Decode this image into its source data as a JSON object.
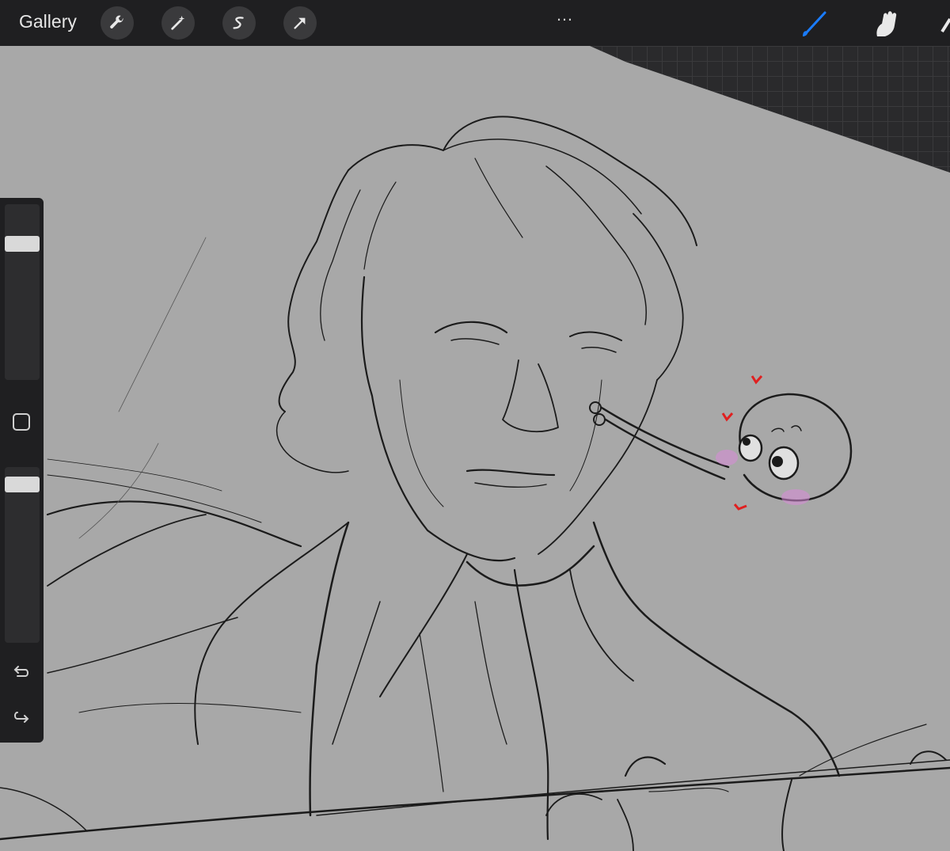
{
  "app": {
    "gallery_label": "Gallery",
    "more_icon": "…"
  },
  "toolbar": {
    "left_tools": [
      "actions-wrench-icon",
      "adjustments-wand-icon",
      "selection-s-icon",
      "transform-arrow-icon"
    ],
    "right_tools": [
      "brush-icon",
      "smudge-icon",
      "eraser-icon"
    ],
    "active_tool": "brush-icon",
    "accent_color": "#1a7cff"
  },
  "sidebar": {
    "brush_size_level": 0.8,
    "opacity_level": 0.94,
    "modify_button": "square-icon",
    "undo_icon": "undo-icon",
    "redo_icon": "redo-icon"
  },
  "canvas": {
    "background_color": "#a8a8a8",
    "content": "sketch-drawing"
  }
}
